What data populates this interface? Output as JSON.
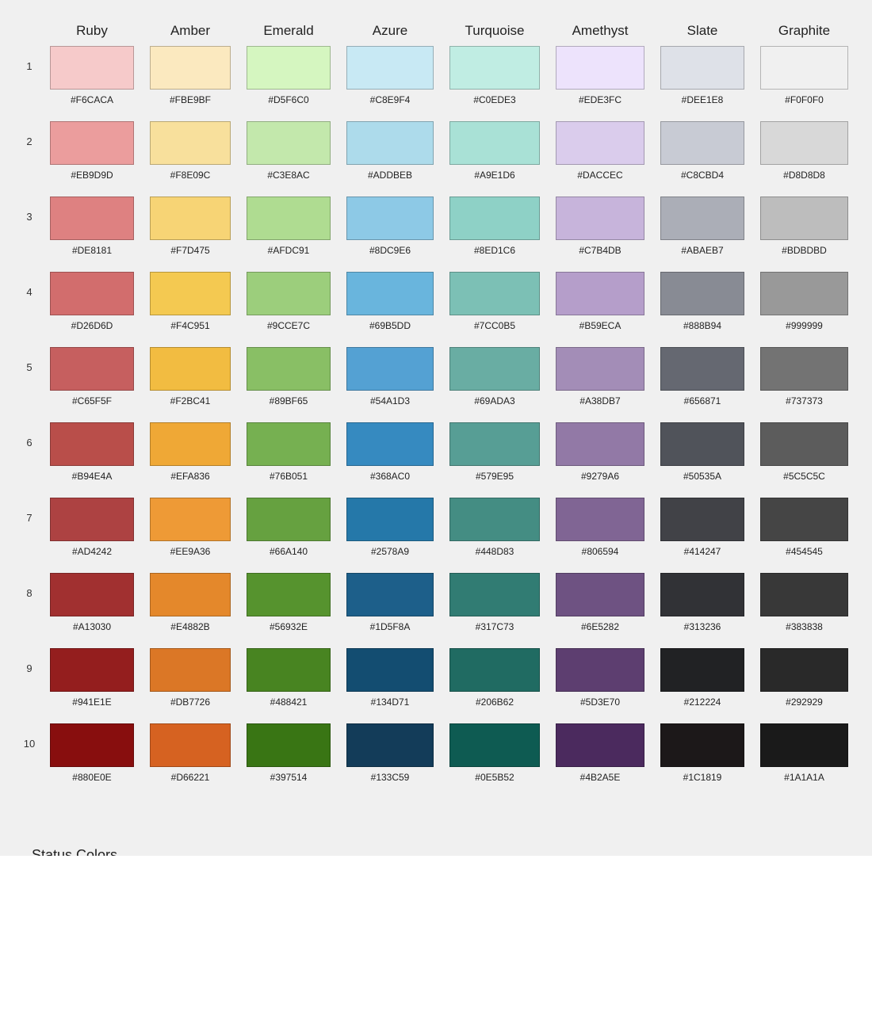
{
  "palette": {
    "columns": [
      "Ruby",
      "Amber",
      "Emerald",
      "Azure",
      "Turquoise",
      "Amethyst",
      "Slate",
      "Graphite"
    ],
    "rows": [
      {
        "label": "1",
        "colors": [
          "#F6CACA",
          "#FBE9BF",
          "#D5F6C0",
          "#C8E9F4",
          "#C0EDE3",
          "#EDE3FC",
          "#DEE1E8",
          "#F0F0F0"
        ]
      },
      {
        "label": "2",
        "colors": [
          "#EB9D9D",
          "#F8E09C",
          "#C3E8AC",
          "#ADDBEB",
          "#A9E1D6",
          "#DACCEC",
          "#C8CBD4",
          "#D8D8D8"
        ]
      },
      {
        "label": "3",
        "colors": [
          "#DE8181",
          "#F7D475",
          "#AFDC91",
          "#8DC9E6",
          "#8ED1C6",
          "#C7B4DB",
          "#ABAEB7",
          "#BDBDBD"
        ]
      },
      {
        "label": "4",
        "colors": [
          "#D26D6D",
          "#F4C951",
          "#9CCE7C",
          "#69B5DD",
          "#7CC0B5",
          "#B59ECA",
          "#888B94",
          "#999999"
        ]
      },
      {
        "label": "5",
        "colors": [
          "#C65F5F",
          "#F2BC41",
          "#89BF65",
          "#54A1D3",
          "#69ADA3",
          "#A38DB7",
          "#656871",
          "#737373"
        ]
      },
      {
        "label": "6",
        "colors": [
          "#B94E4A",
          "#EFA836",
          "#76B051",
          "#368AC0",
          "#579E95",
          "#9279A6",
          "#50535A",
          "#5C5C5C"
        ]
      },
      {
        "label": "7",
        "colors": [
          "#AD4242",
          "#EE9A36",
          "#66A140",
          "#2578A9",
          "#448D83",
          "#806594",
          "#414247",
          "#454545"
        ]
      },
      {
        "label": "8",
        "colors": [
          "#A13030",
          "#E4882B",
          "#56932E",
          "#1D5F8A",
          "#317C73",
          "#6E5282",
          "#313236",
          "#383838"
        ]
      },
      {
        "label": "9",
        "colors": [
          "#941E1E",
          "#DB7726",
          "#488421",
          "#134D71",
          "#206B62",
          "#5D3E70",
          "#212224",
          "#292929"
        ]
      },
      {
        "label": "10",
        "colors": [
          "#880E0E",
          "#D66221",
          "#397514",
          "#133C59",
          "#0E5B52",
          "#4B2A5E",
          "#1C1819",
          "#1A1A1A"
        ]
      }
    ]
  },
  "status": {
    "title": "Status Colors"
  }
}
